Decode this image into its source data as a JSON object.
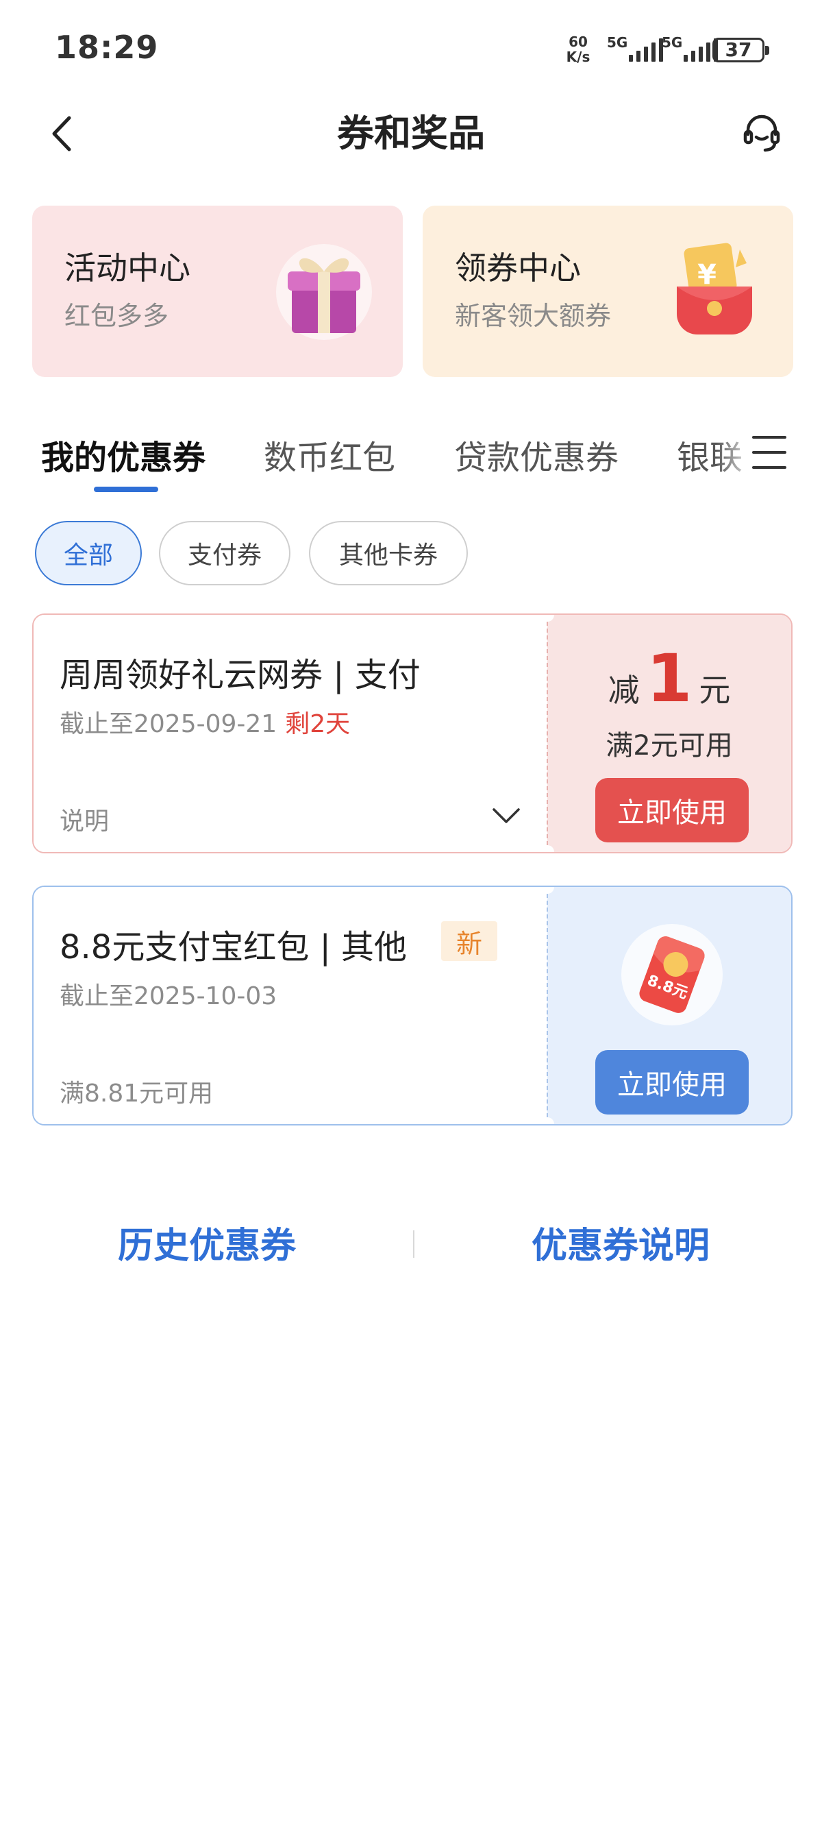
{
  "status_bar": {
    "time": "18:29",
    "net_speed_value": "60",
    "net_speed_unit": "K/s",
    "signal1_label": "5G",
    "signal2_label": "5G",
    "battery": "37"
  },
  "nav": {
    "title": "券和奖品",
    "back_icon": "chevron-left-icon",
    "service_icon": "headset-icon"
  },
  "entries": [
    {
      "title": "活动中心",
      "subtitle": "红包多多",
      "icon": "gift-box-icon"
    },
    {
      "title": "领券中心",
      "subtitle": "新客领大额券",
      "icon": "red-envelope-yuan-icon"
    }
  ],
  "tabs": [
    {
      "label": "我的优惠券",
      "active": true
    },
    {
      "label": "数币红包",
      "active": false
    },
    {
      "label": "贷款优惠券",
      "active": false
    },
    {
      "label": "银联",
      "active": false
    }
  ],
  "filter_chips": [
    {
      "label": "全部",
      "active": true
    },
    {
      "label": "支付券",
      "active": false
    },
    {
      "label": "其他卡券",
      "active": false
    }
  ],
  "coupons": [
    {
      "title": "周周领好礼云网券 | 支付",
      "expiry": "截止至2025-09-21",
      "remaining": "剩2天",
      "footer": "说明",
      "amount_prefix": "减",
      "amount": "1",
      "amount_unit": "元",
      "condition": "满2元可用",
      "button": "立即使用"
    },
    {
      "title": "8.8元支付宝红包 | 其他",
      "tag": "新",
      "expiry": "截止至2025-10-03",
      "footer": "满8.81元可用",
      "image_text": "8.8元",
      "button": "立即使用"
    }
  ],
  "bottom_links": {
    "history": "历史优惠券",
    "explain": "优惠券说明"
  },
  "colors": {
    "brand_blue": "#2f6fd6",
    "accent_red": "#e4514f",
    "activity_bg": "#fbe4e5",
    "coupon_center_bg": "#fdefdd"
  }
}
